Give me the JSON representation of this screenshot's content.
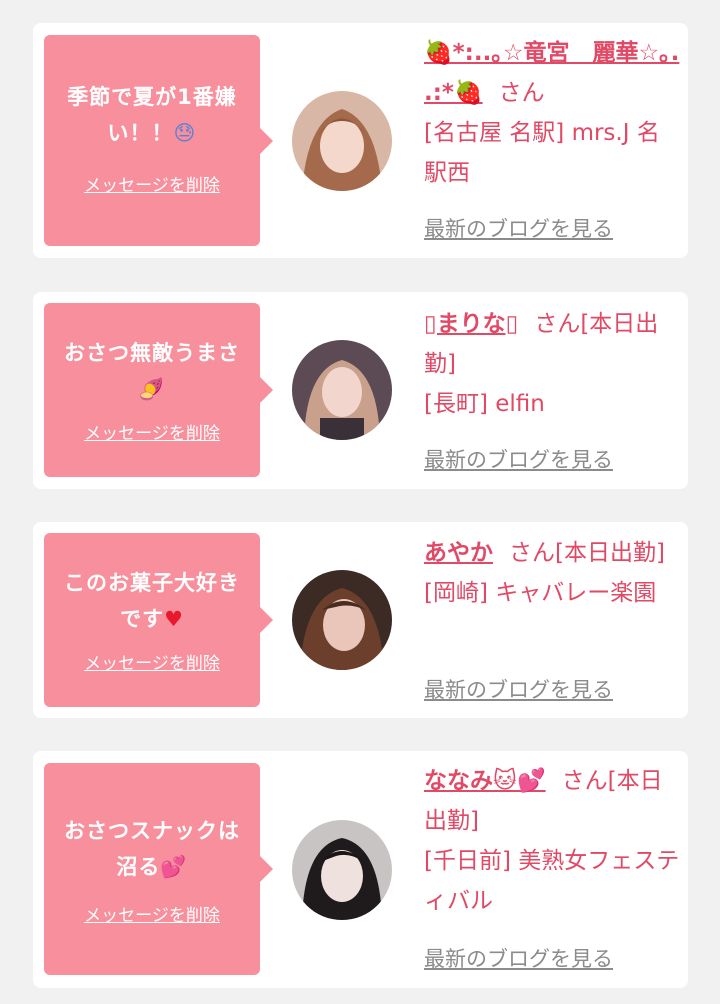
{
  "cards": [
    {
      "message": "季節で夏が1番嫌い！！",
      "message_emoji": "😓",
      "delete_label": "メッセージを削除",
      "name": "🍓*:..｡☆竜宮　麗華☆｡. .:*🍓",
      "name_suffix": "さん",
      "shop": "[名古屋 名駅] mrs.J 名駅西",
      "blog_label": "最新のブログを見る"
    },
    {
      "message": "おさつ無敵うまさ",
      "message_emoji": "🍠",
      "delete_label": "メッセージを削除",
      "name": "▯まりな▯",
      "name_suffix": "さん[本日出勤]",
      "shop": "[長町] elfin",
      "blog_label": "最新のブログを見る"
    },
    {
      "message": "このお菓子大好きです",
      "message_emoji": "♥",
      "delete_label": "メッセージを削除",
      "name": "あやか",
      "name_suffix": "さん[本日出勤]",
      "shop": "[岡崎] キャバレー楽園",
      "blog_label": "最新のブログを見る"
    },
    {
      "message": "おさつスナックは沼る",
      "message_emoji": "💕",
      "delete_label": "メッセージを削除",
      "name": "ななみ🐱💕",
      "name_suffix": "さん[本日出勤]",
      "shop": "[千日前] 美熟女フェスティバル",
      "blog_label": "最新のブログを見る"
    }
  ],
  "colors": {
    "page_bg": "#f1f1f1",
    "card_bg": "#ffffff",
    "bubble_bg": "#f7909c",
    "accent_text": "#e04a66",
    "link_gray": "#8b8b8b"
  }
}
